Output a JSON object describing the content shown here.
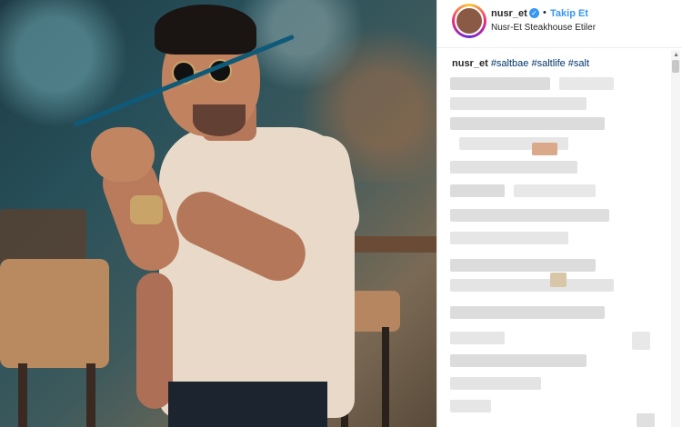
{
  "post": {
    "username": "nusr_et",
    "verified_mark": "✓",
    "separator": "•",
    "follow_label": "Takip Et",
    "location": "Nusr-Et Steakhouse Etiler"
  },
  "caption": {
    "username": "nusr_et",
    "hashtags": "#saltbae #saltlife #salt"
  },
  "icons": {
    "verified": "verified-badge-icon",
    "scroll_up": "scroll-up-arrow-icon"
  },
  "colors": {
    "link_blue": "#3897f0",
    "hashtag_blue": "#003569",
    "text": "#262626"
  }
}
